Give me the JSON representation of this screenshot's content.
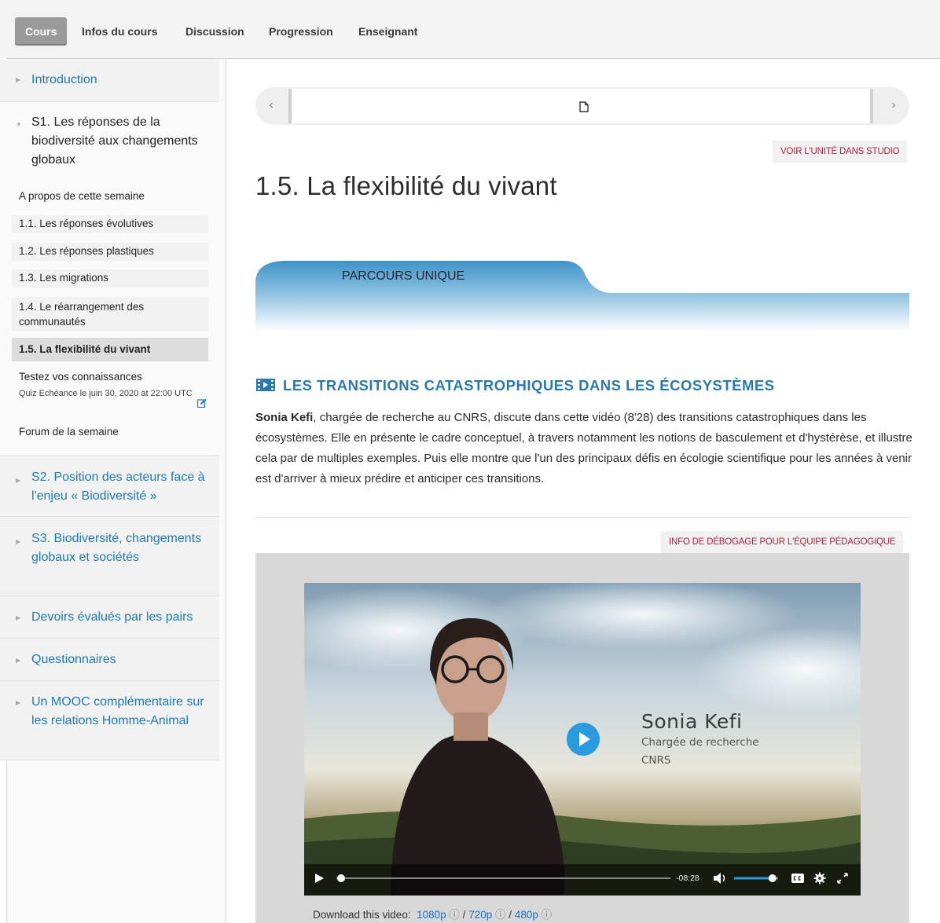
{
  "tabs": [
    {
      "label": "Cours",
      "active": true
    },
    {
      "label": "Infos du cours"
    },
    {
      "label": "Discussion"
    },
    {
      "label": "Progression"
    },
    {
      "label": "Enseignant"
    }
  ],
  "sidebar": {
    "sections": [
      {
        "title": "Introduction"
      },
      {
        "title": "S1. Les réponses de la biodiversité aux changements globaux",
        "expanded": true
      },
      {
        "title": "S2. Position des acteurs face à l'enjeu « Biodiversité »"
      },
      {
        "title": "S3. Biodiversité, changements globaux et sociétés"
      },
      {
        "title": "Devoirs évalués par les pairs"
      },
      {
        "title": "Questionnaires"
      },
      {
        "title": "Un MOOC complémentaire sur les relations Homme-Animal"
      }
    ],
    "subsections": [
      {
        "label": "A propos de cette semaine"
      },
      {
        "label": "1.1. Les réponses évolutives"
      },
      {
        "label": "1.2. Les réponses plastiques"
      },
      {
        "label": "1.3. Les migrations"
      },
      {
        "label": "1.4. Le réarrangement des communautés"
      },
      {
        "label": "1.5. La flexibilité du vivant",
        "active": true
      },
      {
        "label": "Testez vos connaissances"
      },
      {
        "label": "Forum de la semaine"
      }
    ],
    "quiz_meta": "Quiz Echéance le juin 30, 2020 at 22:00 UTC"
  },
  "content": {
    "studio_button": "VOIR L'UNITÉ DANS STUDIO",
    "unit_title": "1.5. La flexibilité du vivant",
    "banner_label": "PARCOURS UNIQUE",
    "video_heading": "LES TRANSITIONS CATASTROPHIQUES DANS LES ÉCOSYSTÈMES",
    "description_bold": "Sonia Kefi",
    "description_rest": ", chargée de recherche au CNRS, discute dans cette vidéo (8'28) des transitions catastrophiques dans les écosystèmes. Elle en présente le cadre conceptuel, à travers notamment les notions de basculement et d'hystérèse, et illustre cela par de multiples exemples. Puis elle montre que l'un des principaux défis en écologie scientifique pour les années à venir est d'arriver à mieux prédire et anticiper ces transitions.",
    "debug_button": "INFO DE DÉBOGAGE POUR L'ÉQUIPE PÉDAGOGIQUE"
  },
  "video": {
    "speaker_name": "Sonia Kefi",
    "speaker_role": "Chargée de recherche",
    "speaker_org": "CNRS",
    "time_remaining": "-08:28",
    "progress": 0.0,
    "volume": 0.8,
    "download_label": "Download this video:",
    "downloads": [
      "1080p",
      "720p",
      "480p"
    ],
    "info_glyph": "ⓘ",
    "separator": "/"
  },
  "colors": {
    "link": "#1e7ab7",
    "heading": "#2a78b0",
    "staff_button_text": "#b0223c",
    "active_tab": "#9a9a9a",
    "play_button": "#2b9be0"
  }
}
